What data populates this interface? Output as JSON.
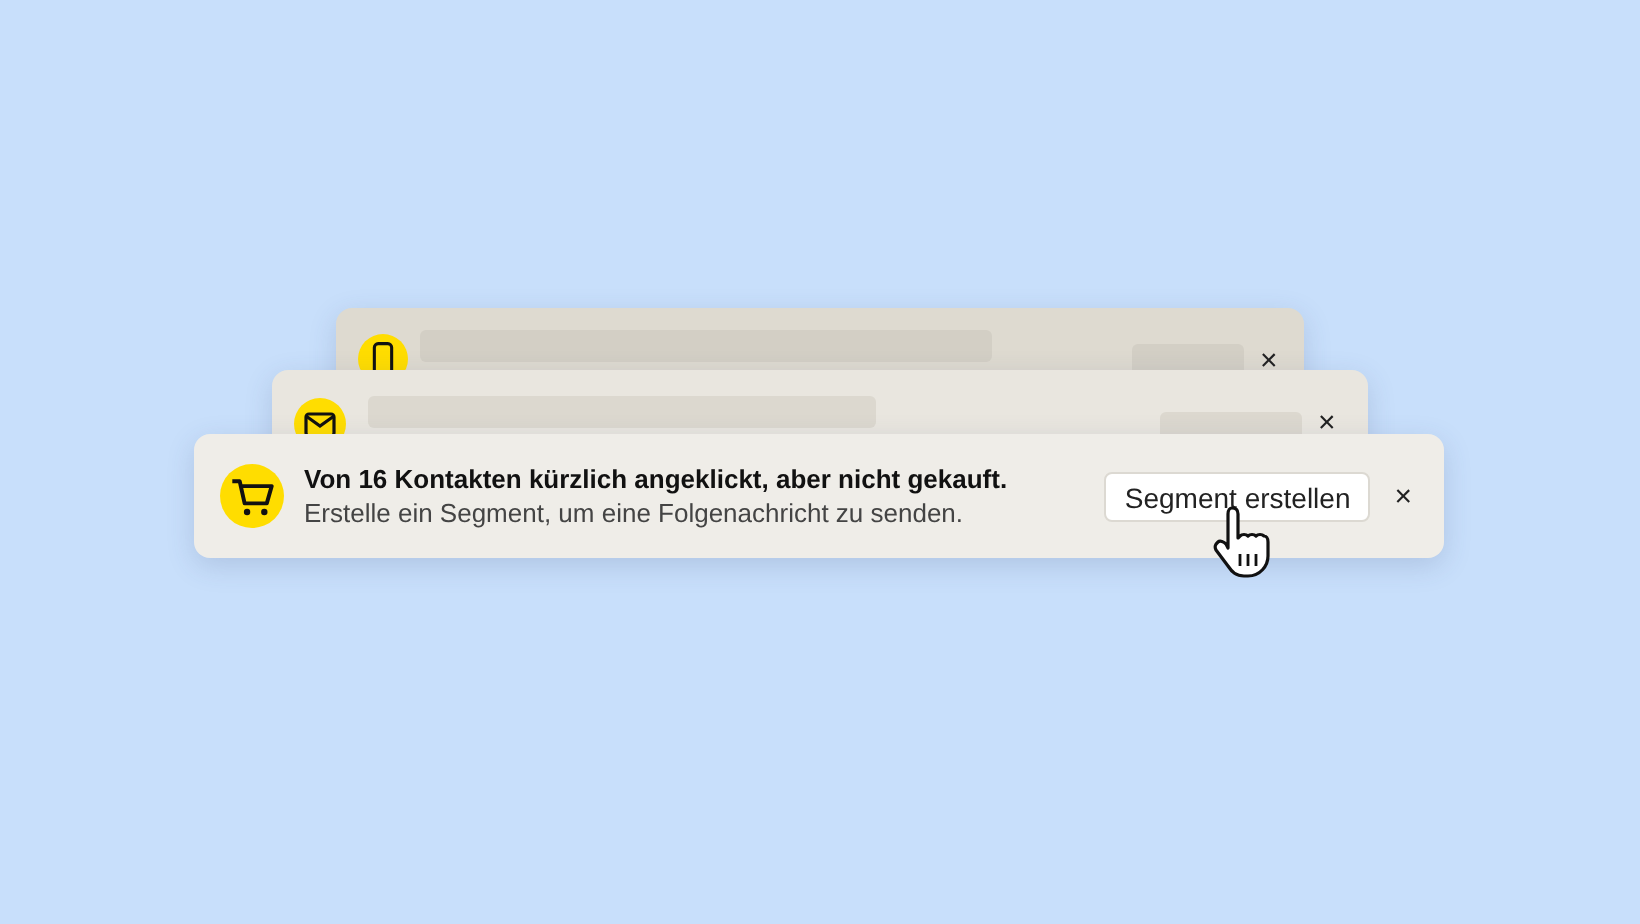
{
  "cards": [
    {
      "kind": "placeholder",
      "close": "×"
    },
    {
      "kind": "placeholder",
      "close": "×"
    },
    {
      "kind": "message",
      "title": "Von 16 Kontakten kürzlich angeklickt, aber nicht gekauft.",
      "text": "Erstelle ein Segment, um eine Folgenachricht zu senden.",
      "button": "Segment erstellen",
      "close": "×"
    }
  ]
}
